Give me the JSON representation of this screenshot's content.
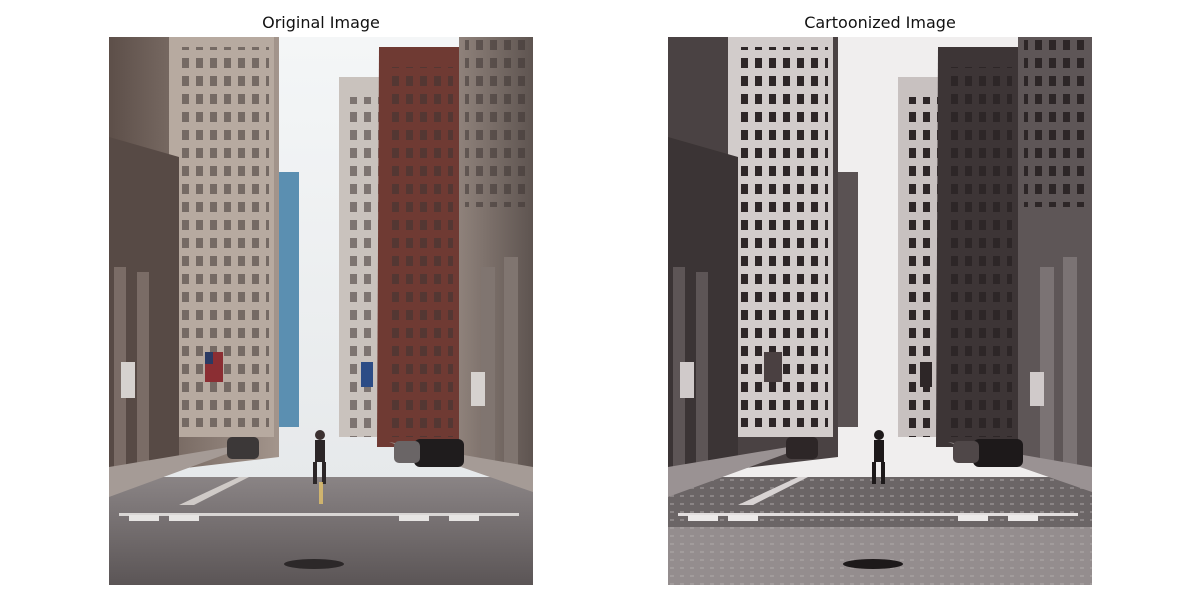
{
  "panels": [
    {
      "title": "Original Image"
    },
    {
      "title": "Cartoonized Image"
    }
  ],
  "images": [
    {
      "name": "original-street-photo",
      "style": "photo"
    },
    {
      "name": "cartoonized-street-photo",
      "style": "cartoon"
    }
  ],
  "colors": {
    "background": "#ffffff",
    "sky": "#eef1f3",
    "road": "#6b6566",
    "left_building": "#8e7a70",
    "right_brick_building": "#6f3a33",
    "glass_tower": "#5b8fb1"
  }
}
